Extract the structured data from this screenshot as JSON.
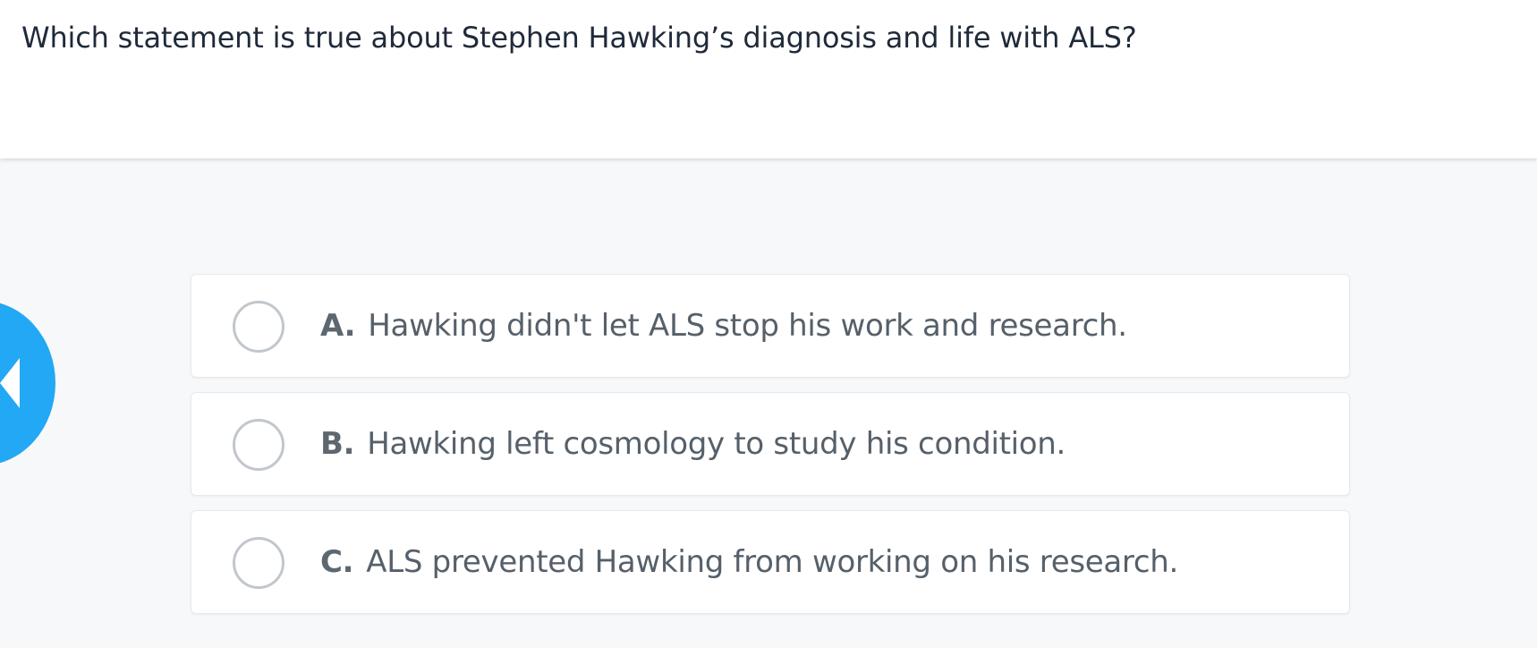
{
  "question": {
    "text": "Which statement is true about Stephen Hawking’s diagnosis and life with ALS?"
  },
  "navigation": {
    "back_icon": "chevron-left-icon",
    "accent_color": "#22a8f4"
  },
  "options": [
    {
      "letter": "A.",
      "text": "Hawking didn't let ALS stop his work and research."
    },
    {
      "letter": "B.",
      "text": "Hawking left cosmology to study his condition."
    },
    {
      "letter": "C.",
      "text": "ALS prevented Hawking from working on his research."
    }
  ]
}
